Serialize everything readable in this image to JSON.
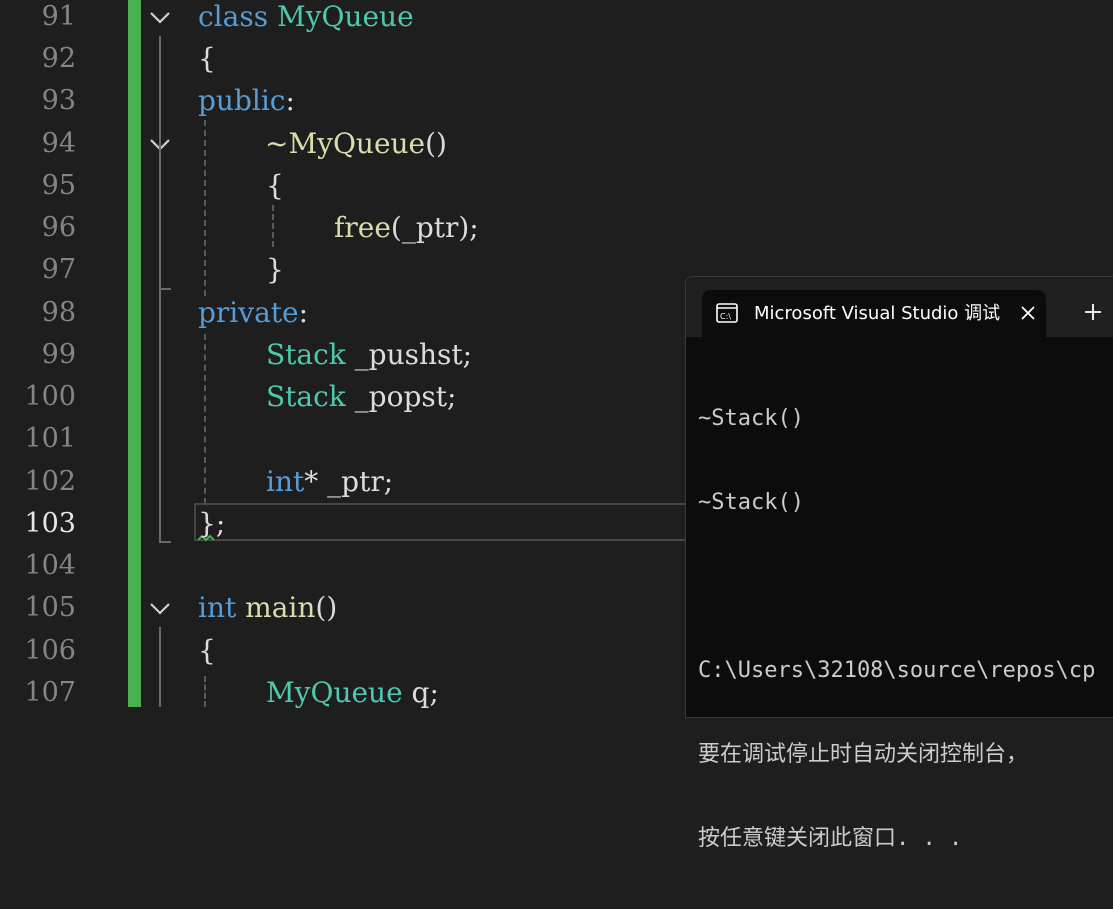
{
  "editor": {
    "line_numbers": [
      "91",
      "92",
      "93",
      "94",
      "95",
      "96",
      "97",
      "98",
      "99",
      "100",
      "101",
      "102",
      "103",
      "104",
      "105",
      "106",
      "107"
    ],
    "current_line": "103",
    "lines": {
      "l91": {
        "kw": "class",
        "name": "MyQueue"
      },
      "l92": {
        "text": "{"
      },
      "l93": {
        "kw": "public",
        "punct": ":"
      },
      "l94": {
        "tilde": "~",
        "fn": "MyQueue",
        "rest": "()"
      },
      "l95": {
        "text": "{"
      },
      "l96": {
        "fn": "free",
        "rest": "(_ptr);"
      },
      "l97": {
        "text": "}"
      },
      "l98": {
        "kw": "private",
        "punct": ":"
      },
      "l99": {
        "type": "Stack",
        "rest": " _pushst;"
      },
      "l100": {
        "type": "Stack",
        "rest": " _popst;"
      },
      "l102": {
        "kw": "int",
        "rest": "* _ptr;"
      },
      "l103": {
        "text": "};"
      },
      "l105": {
        "kw": "int",
        "fn": "main",
        "rest": "()"
      },
      "l106": {
        "text": "{"
      },
      "l107": {
        "type": "MyQueue",
        "rest": " q;"
      }
    }
  },
  "console": {
    "tab_title": "Microsoft Visual Studio 调试控",
    "icon": "terminal-icon",
    "close_icon": "close-icon",
    "new_tab_icon": "plus-icon",
    "output": [
      "~Stack()",
      "~Stack()",
      "",
      "C:\\Users\\32108\\source\\repos\\cp",
      "要在调试停止时自动关闭控制台，",
      "按任意键关闭此窗口. . ."
    ]
  },
  "colors": {
    "background": "#1e1e1e",
    "keyword": "#569cd6",
    "type": "#4ec9b0",
    "function": "#dcdcaa",
    "change_bar": "#4caf50"
  }
}
